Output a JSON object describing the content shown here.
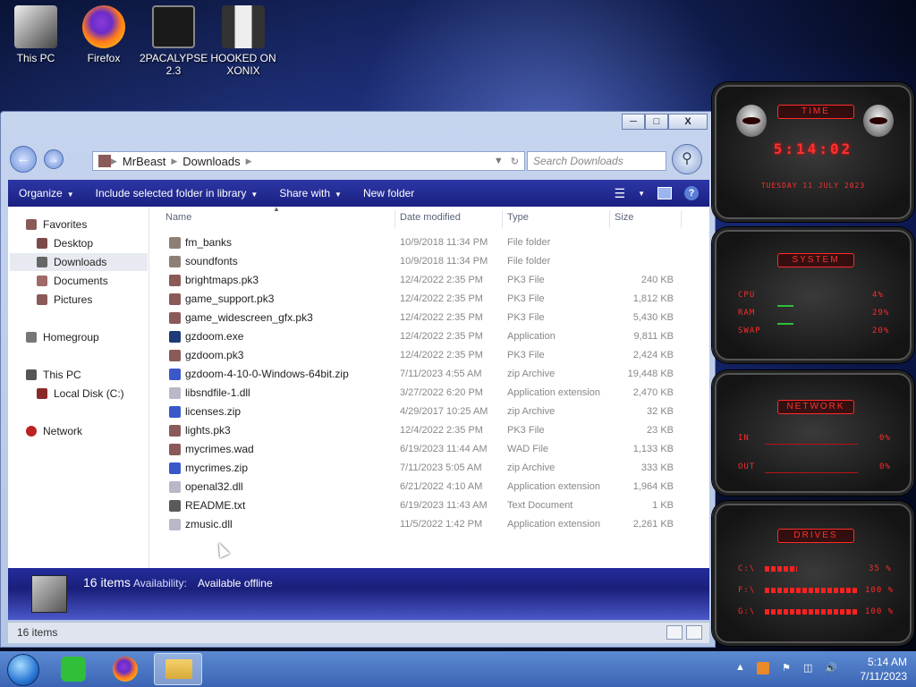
{
  "desktop": {
    "icons": [
      {
        "label": "This PC"
      },
      {
        "label": "Firefox"
      },
      {
        "label": "2PACALYPSE 2.3"
      },
      {
        "label": "HOOKED ON XONIX"
      }
    ]
  },
  "window": {
    "buttons": {
      "minimize": "─",
      "maximize": "□",
      "close": "X"
    },
    "nav": {
      "back": "←",
      "forward": "→"
    },
    "address": {
      "segments": [
        "MrBeast",
        "Downloads"
      ]
    },
    "search": {
      "placeholder": "Search Downloads"
    },
    "commandbar": {
      "organize": "Organize",
      "include": "Include selected folder in library",
      "share": "Share with",
      "new_folder": "New folder",
      "help": "?"
    },
    "sidebar": {
      "favorites": "Favorites",
      "desktop": "Desktop",
      "downloads": "Downloads",
      "documents": "Documents",
      "pictures": "Pictures",
      "homegroup": "Homegroup",
      "this_pc": "This PC",
      "local_disk": "Local Disk (C:)",
      "network": "Network"
    },
    "columns": {
      "name": "Name",
      "date": "Date modified",
      "type": "Type",
      "size": "Size"
    },
    "files": [
      {
        "name": "fm_banks",
        "date": "10/9/2018 11:34 PM",
        "type": "File folder",
        "size": "",
        "icon": "folder-icon",
        "color": "#8d7f78"
      },
      {
        "name": "soundfonts",
        "date": "10/9/2018 11:34 PM",
        "type": "File folder",
        "size": "",
        "icon": "folder-icon",
        "color": "#8d7f78"
      },
      {
        "name": "brightmaps.pk3",
        "date": "12/4/2022 2:35 PM",
        "type": "PK3 File",
        "size": "240 KB",
        "icon": "pk3-file-icon",
        "color": "#8a5a58"
      },
      {
        "name": "game_support.pk3",
        "date": "12/4/2022 2:35 PM",
        "type": "PK3 File",
        "size": "1,812 KB",
        "icon": "pk3-file-icon",
        "color": "#8a5a58"
      },
      {
        "name": "game_widescreen_gfx.pk3",
        "date": "12/4/2022 2:35 PM",
        "type": "PK3 File",
        "size": "5,430 KB",
        "icon": "pk3-file-icon",
        "color": "#8a5a58"
      },
      {
        "name": "gzdoom.exe",
        "date": "12/4/2022 2:35 PM",
        "type": "Application",
        "size": "9,811 KB",
        "icon": "gzdoom-app-icon",
        "color": "#1e3a78"
      },
      {
        "name": "gzdoom.pk3",
        "date": "12/4/2022 2:35 PM",
        "type": "PK3 File",
        "size": "2,424 KB",
        "icon": "pk3-file-icon",
        "color": "#8a5a58"
      },
      {
        "name": "gzdoom-4-10-0-Windows-64bit.zip",
        "date": "7/11/2023 4:55 AM",
        "type": "zip Archive",
        "size": "19,448 KB",
        "icon": "zip-archive-icon",
        "color": "#3b58c8"
      },
      {
        "name": "libsndfile-1.dll",
        "date": "3/27/2022 6:20 PM",
        "type": "Application extension",
        "size": "2,470 KB",
        "icon": "dll-file-icon",
        "color": "#b8b8c8"
      },
      {
        "name": "licenses.zip",
        "date": "4/29/2017 10:25 AM",
        "type": "zip Archive",
        "size": "32 KB",
        "icon": "zip-archive-icon",
        "color": "#3b58c8"
      },
      {
        "name": "lights.pk3",
        "date": "12/4/2022 2:35 PM",
        "type": "PK3 File",
        "size": "23 KB",
        "icon": "pk3-file-icon",
        "color": "#8a5a58"
      },
      {
        "name": "mycrimes.wad",
        "date": "6/19/2023 11:44 AM",
        "type": "WAD File",
        "size": "1,133 KB",
        "icon": "wad-file-icon",
        "color": "#8a5a58"
      },
      {
        "name": "mycrimes.zip",
        "date": "7/11/2023 5:05 AM",
        "type": "zip Archive",
        "size": "333 KB",
        "icon": "zip-archive-icon",
        "color": "#3b58c8"
      },
      {
        "name": "openal32.dll",
        "date": "6/21/2022 4:10 AM",
        "type": "Application extension",
        "size": "1,964 KB",
        "icon": "dll-file-icon",
        "color": "#b8b8c8"
      },
      {
        "name": "README.txt",
        "date": "6/19/2023 11:43 AM",
        "type": "Text Document",
        "size": "1 KB",
        "icon": "text-file-icon",
        "color": "#5a5a5a"
      },
      {
        "name": "zmusic.dll",
        "date": "11/5/2022 1:42 PM",
        "type": "Application extension",
        "size": "2,261 KB",
        "icon": "dll-file-icon",
        "color": "#b8b8c8"
      }
    ],
    "details": {
      "count": "16 items",
      "availability_label": "Availability:",
      "availability_value": "Available offline"
    },
    "status": {
      "count": "16 items"
    }
  },
  "gadgets": {
    "time": {
      "title": "TIME",
      "value": "5:14:02",
      "date": "TUESDAY 11 JULY 2023"
    },
    "system": {
      "title": "SYSTEM",
      "cpu_label": "CPU",
      "cpu_value": "4%",
      "ram_label": "RAM",
      "ram_value": "29%",
      "swap_label": "SWAP",
      "swap_value": "20%"
    },
    "network": {
      "title": "NETWORK",
      "in_label": "IN",
      "in_value": "0%",
      "out_label": "OUT",
      "out_value": "0%"
    },
    "drives": {
      "title": "DRIVES",
      "d1_label": "C:\\",
      "d1_value": "35 %",
      "d2_label": "F:\\",
      "d2_value": "100 %",
      "d3_label": "G:\\",
      "d3_value": "100 %"
    }
  },
  "taskbar": {
    "clock_time": "5:14 AM",
    "clock_date": "7/11/2023",
    "colors": {
      "accent": "#3b65b4",
      "gadget_red": "#ff3030",
      "cmdbar": "#2c36a6"
    }
  }
}
